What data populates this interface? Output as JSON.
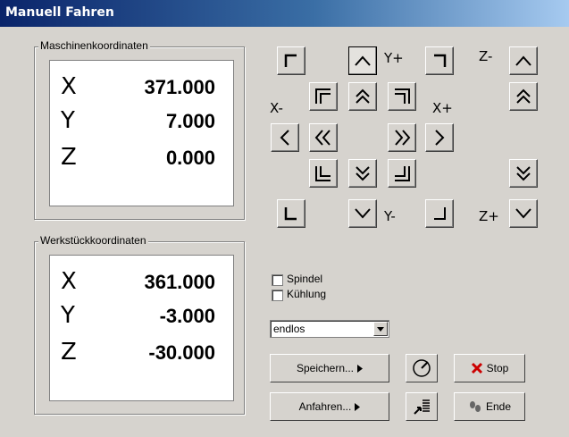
{
  "window": {
    "title": "Manuell Fahren"
  },
  "machine": {
    "label": "Maschinenkoordinaten",
    "rows": [
      {
        "axis": "X",
        "value": "371.000"
      },
      {
        "axis": "Y",
        "value": "7.000"
      },
      {
        "axis": "Z",
        "value": "0.000"
      }
    ]
  },
  "workpiece": {
    "label": "Werkstückkoordinaten",
    "rows": [
      {
        "axis": "X",
        "value": "361.000"
      },
      {
        "axis": "Y",
        "value": "-3.000"
      },
      {
        "axis": "Z",
        "value": "-30.000"
      }
    ]
  },
  "jog_labels": {
    "y_plus": "Y+",
    "y_minus": "Y-",
    "x_minus": "X-",
    "x_plus": "X+",
    "z_minus": "Z-",
    "z_plus": "Z+"
  },
  "options": {
    "spindle_label": "Spindel",
    "spindle_checked": false,
    "coolant_label": "Kühlung",
    "coolant_checked": false
  },
  "mode_select": {
    "value": "endlos"
  },
  "buttons": {
    "save": "Speichern...",
    "approach": "Anfahren...",
    "stop": "Stop",
    "end": "Ende"
  },
  "icons": {
    "stop": "red-x-icon",
    "end": "footprints-icon",
    "probe": "gauge-needle-icon",
    "move_to": "arrow-to-list-icon"
  }
}
